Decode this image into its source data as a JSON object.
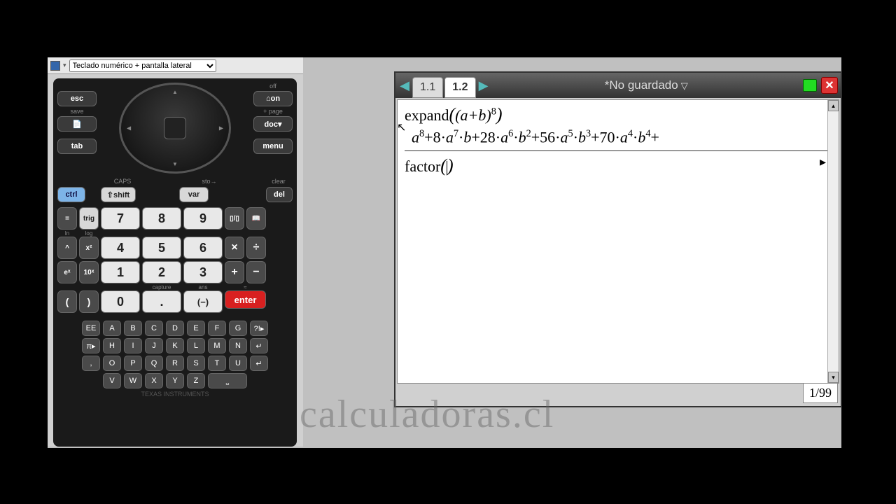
{
  "dropdown": {
    "value": "Teclado numérico + pantalla lateral"
  },
  "top_keys": {
    "esc": "esc",
    "save": "save",
    "tab": "tab",
    "off": "off",
    "on": "⌂on",
    "plus_page": "+ page",
    "doc": "doc▾",
    "menu": "menu"
  },
  "mod_row": {
    "caps": "CAPS",
    "sto": "sto→",
    "clear": "clear",
    "ctrl": "ctrl",
    "shift": "⇧shift",
    "var": "var",
    "del": "del"
  },
  "numpad": {
    "eq": "=",
    "trig": "trig",
    "7": "7",
    "8": "8",
    "9": "9",
    "4": "4",
    "5": "5",
    "6": "6",
    "1": "1",
    "2": "2",
    "3": "3",
    "0": "0",
    "dot": ".",
    "neg": "(−)",
    "enter": "enter",
    "caret": "^",
    "x2": "x²",
    "times": "×",
    "div": "÷",
    "ex": "eˣ",
    "tenx": "10ˣ",
    "plus": "+",
    "minus": "−",
    "lparen": "(",
    "rparen": ")",
    "ln": "ln",
    "log": "log",
    "capture": "capture",
    "ans": "ans",
    "approx": "≈"
  },
  "alpha": {
    "row1": [
      "EE",
      "A",
      "B",
      "C",
      "D",
      "E",
      "F",
      "G",
      "?!▸"
    ],
    "row2": [
      "π▸",
      "H",
      "I",
      "J",
      "K",
      "L",
      "M",
      "N",
      "↵"
    ],
    "row3": [
      ",",
      "O",
      "P",
      "Q",
      "R",
      "S",
      "T",
      "U",
      "↵"
    ],
    "row4": [
      "V",
      "W",
      "X",
      "Y",
      "Z"
    ]
  },
  "brand": "TEXAS INSTRUMENTS",
  "screen": {
    "tabs": [
      "1.1",
      "1.2"
    ],
    "active_tab": 1,
    "title": "*No guardado",
    "line1_func": "expand",
    "line1_arg_base": "(a+b)",
    "line1_arg_exp": "8",
    "result_terms": [
      {
        "coef": "",
        "a": "8",
        "b": ""
      },
      {
        "coef": "+8·",
        "a": "7",
        "b": "·b"
      },
      {
        "coef": "+28·",
        "a": "6",
        "b": "·b",
        "bexp": "2"
      },
      {
        "coef": "+56·",
        "a": "5",
        "b": "·b",
        "bexp": "3"
      },
      {
        "coef": "+70·",
        "a": "4",
        "b": "·b",
        "bexp": "4"
      }
    ],
    "result_trail": "+",
    "line2": "factor(|)",
    "page": "1/99"
  },
  "watermark": "calculadoras.cl"
}
